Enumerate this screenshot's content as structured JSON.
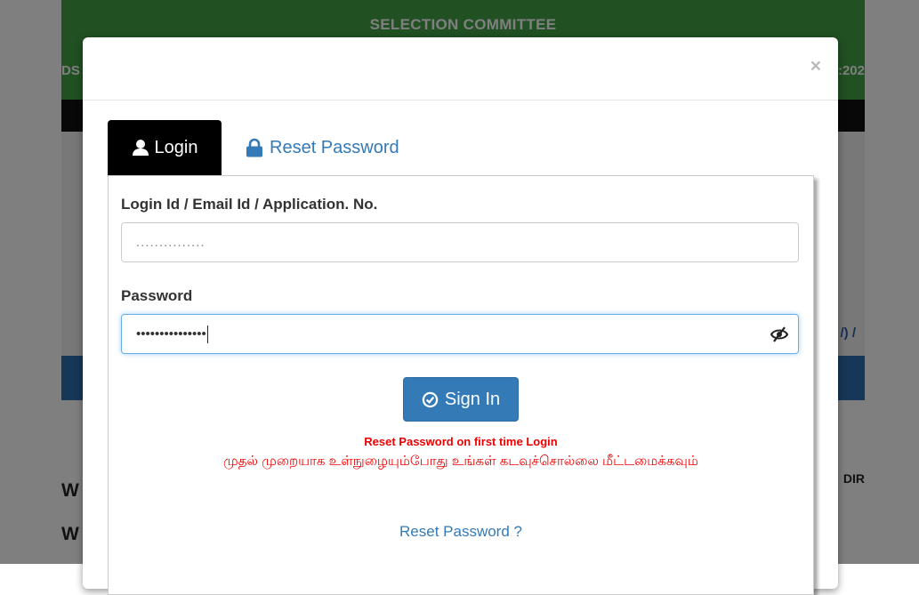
{
  "background": {
    "title": "SELECTION COMMITTEE",
    "left_fragment": "DS",
    "right_fragment": ":202",
    "link_fragment": "/) /",
    "w1": "W",
    "w2": "W",
    "dir": "DIR"
  },
  "modal": {
    "close_label": "×",
    "tabs": [
      {
        "label": "Login",
        "icon": "user-icon",
        "active": true
      },
      {
        "label": "Reset Password",
        "icon": "lock-icon",
        "active": false
      }
    ],
    "login_field": {
      "label": "Login Id / Email Id / Application. No.",
      "value": "..............."
    },
    "password_field": {
      "label": "Password",
      "value": "•••••••••••••••"
    },
    "signin_label": "Sign In",
    "message_en": "Reset Password on first time Login",
    "message_ta": "முதல் முறையாக உள்நுழையும்போது உங்கள் கடவுச்சொல்லை மீட்டமைக்கவும்",
    "reset_link": "Reset Password ?"
  },
  "colors": {
    "header_green": "#43a047",
    "primary_blue": "#337ab7",
    "alert_red": "#e00000"
  }
}
